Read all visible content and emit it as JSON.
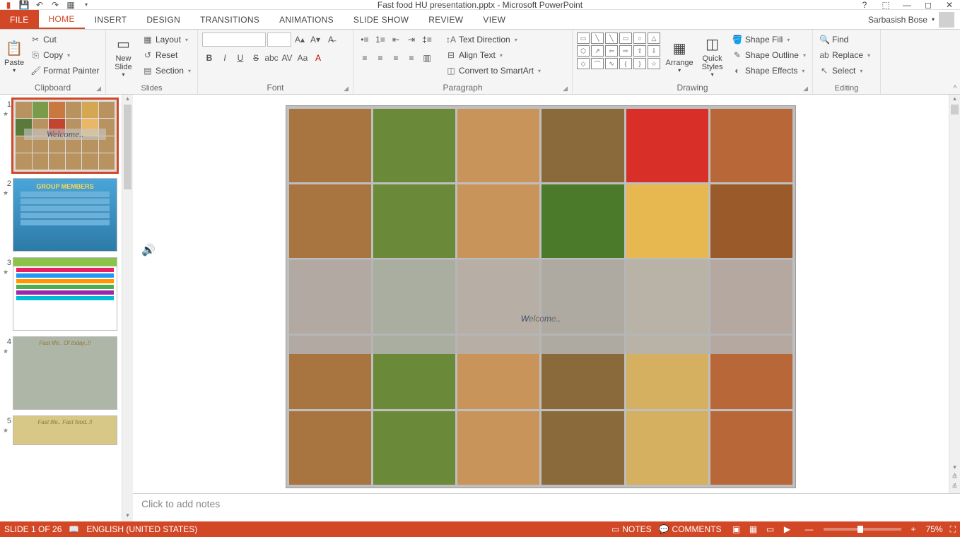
{
  "title": "Fast food HU presentation.pptx - Microsoft PowerPoint",
  "account": {
    "name": "Sarbasish Bose"
  },
  "tabs": {
    "file": "FILE",
    "home": "HOME",
    "insert": "INSERT",
    "design": "DESIGN",
    "transitions": "TRANSITIONS",
    "animations": "ANIMATIONS",
    "slideshow": "SLIDE SHOW",
    "review": "REVIEW",
    "view": "VIEW",
    "active": "home"
  },
  "ribbon": {
    "clipboard": {
      "label": "Clipboard",
      "paste": "Paste",
      "cut": "Cut",
      "copy": "Copy",
      "formatPainter": "Format Painter"
    },
    "slides": {
      "label": "Slides",
      "newSlide": "New\nSlide",
      "layout": "Layout",
      "reset": "Reset",
      "section": "Section"
    },
    "font": {
      "label": "Font",
      "family": "",
      "size": ""
    },
    "paragraph": {
      "label": "Paragraph",
      "textDirection": "Text Direction",
      "alignText": "Align Text",
      "convertSmartArt": "Convert to SmartArt"
    },
    "drawing": {
      "label": "Drawing",
      "arrange": "Arrange",
      "quickStyles": "Quick\nStyles",
      "shapeFill": "Shape Fill",
      "shapeOutline": "Shape Outline",
      "shapeEffects": "Shape Effects"
    },
    "editing": {
      "label": "Editing",
      "find": "Find",
      "replace": "Replace",
      "select": "Select"
    }
  },
  "slides": {
    "current": 1,
    "total": 26,
    "thumbnails": [
      {
        "num": 1,
        "title": "Welcome..",
        "type": "collage"
      },
      {
        "num": 2,
        "title": "GROUP MEMBERS",
        "type": "members"
      },
      {
        "num": 3,
        "title": "",
        "type": "dangers"
      },
      {
        "num": 4,
        "title": "Fast life.. Of today..!!",
        "type": "text-image"
      },
      {
        "num": 5,
        "title": "Fast life.. Fast food..!!",
        "type": "text"
      }
    ]
  },
  "canvas": {
    "welcome": "Welcome.."
  },
  "notes": {
    "placeholder": "Click to add notes"
  },
  "status": {
    "slideInfo": "SLIDE 1 OF 26",
    "language": "ENGLISH (UNITED STATES)",
    "notes": "NOTES",
    "comments": "COMMENTS",
    "zoom": "75%"
  }
}
